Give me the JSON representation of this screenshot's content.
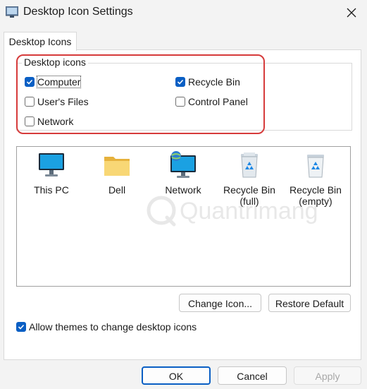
{
  "window": {
    "title": "Desktop Icon Settings"
  },
  "tab": {
    "label": "Desktop Icons"
  },
  "group": {
    "legend": "Desktop icons",
    "options": [
      {
        "label": "Computer",
        "checked": true
      },
      {
        "label": "Recycle Bin",
        "checked": true
      },
      {
        "label": "User's Files",
        "checked": false
      },
      {
        "label": "Control Panel",
        "checked": false
      },
      {
        "label": "Network",
        "checked": false
      }
    ]
  },
  "icons": [
    {
      "label": "This PC",
      "icon": "monitor-icon"
    },
    {
      "label": "Dell",
      "icon": "folder-icon"
    },
    {
      "label": "Network",
      "icon": "network-icon"
    },
    {
      "label": "Recycle Bin\n(full)",
      "icon": "recycle-bin-full-icon"
    },
    {
      "label": "Recycle Bin\n(empty)",
      "icon": "recycle-bin-empty-icon"
    }
  ],
  "buttons": {
    "change_icon": "Change Icon...",
    "restore_default": "Restore Default",
    "ok": "OK",
    "cancel": "Cancel",
    "apply": "Apply"
  },
  "allow_themes": {
    "label": "Allow themes to change desktop icons",
    "checked": true
  },
  "watermark": {
    "text": "Quantrimang"
  },
  "colors": {
    "accent": "#0a5fc4",
    "highlight": "#d63b3b"
  }
}
